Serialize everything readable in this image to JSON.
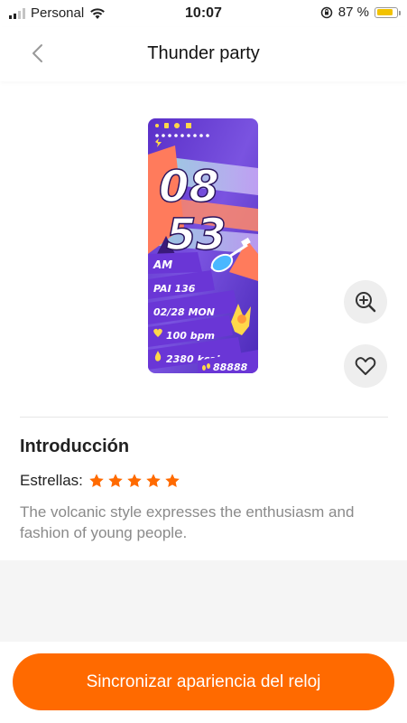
{
  "status_bar": {
    "carrier": "Personal",
    "time": "10:07",
    "battery_percent": "87 %",
    "battery_level": 0.87
  },
  "header": {
    "title": "Thunder party"
  },
  "watchface": {
    "hour": "08",
    "minute": "53",
    "ampm": "AM",
    "pai": "PAI 136",
    "date": "02/28 MON",
    "heart_rate": "100 bpm",
    "calories": "2380 kcal",
    "steps": "88888"
  },
  "intro": {
    "heading": "Introducción",
    "stars_label": "Estrellas:",
    "rating": 5,
    "description": "The volcanic style expresses the enthusiasm and fashion of young people."
  },
  "sync_button": {
    "label": "Sincronizar apariencia del reloj"
  },
  "colors": {
    "accent": "#ff6a00",
    "star": "#ff6a00",
    "panel_purple": "#6a36d6"
  }
}
